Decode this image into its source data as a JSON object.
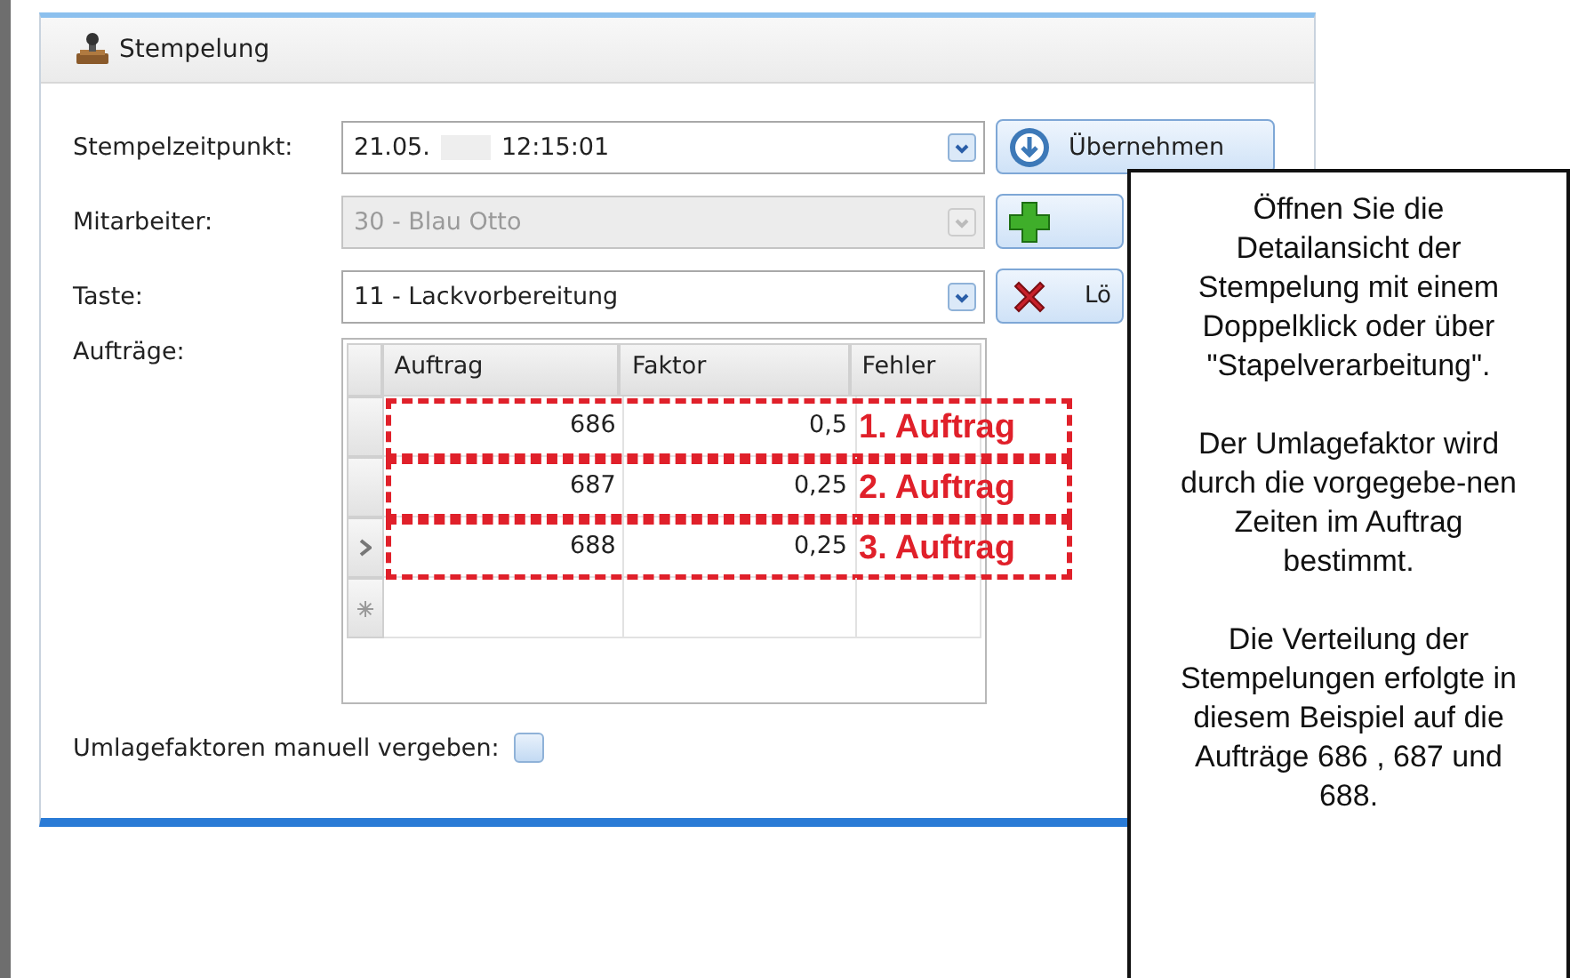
{
  "panel": {
    "title": "Stempelung"
  },
  "fields": [
    {
      "label": "Stempelzeitpunkt:",
      "value": "21.05.",
      "value_2": "12:15:01",
      "disabled": false
    },
    {
      "label": "Mitarbeiter:",
      "value": "30 - Blau Otto",
      "disabled": true
    },
    {
      "label": "Taste:",
      "value": "11 - Lackvorbereitung",
      "disabled": false
    }
  ],
  "buttons": [
    {
      "kind": "apply",
      "label": "Übernehmen"
    },
    {
      "kind": "add"
    },
    {
      "kind": "delete",
      "label": "Lö"
    }
  ],
  "orders": {
    "label": "Aufträge:",
    "columns": [
      "Auftrag",
      "Faktor",
      "Fehler"
    ],
    "rows": [
      {
        "auftrag": "686",
        "faktor": "0,5",
        "annotation": "1. Auftrag",
        "current": false
      },
      {
        "auftrag": "687",
        "faktor": "0,25",
        "annotation": "2. Auftrag",
        "current": false
      },
      {
        "auftrag": "688",
        "faktor": "0,25",
        "annotation": "3. Auftrag",
        "current": true
      }
    ]
  },
  "manual_factors": {
    "label": "Umlagefaktoren manuell vergeben:",
    "checked": false
  },
  "note": {
    "paragraphs": [
      "Öffnen Sie die Detailansicht der Stempelung mit einem Doppelklick oder über \"Stapelverarbeitung\".",
      "Der Umlagefaktor wird durch die vorgegebe-nen Zeiten im Auftrag bestimmt.",
      "Die Verteilung der Stempelungen erfolgte in diesem Beispiel auf die Aufträge 686 , 687 und  688."
    ]
  }
}
